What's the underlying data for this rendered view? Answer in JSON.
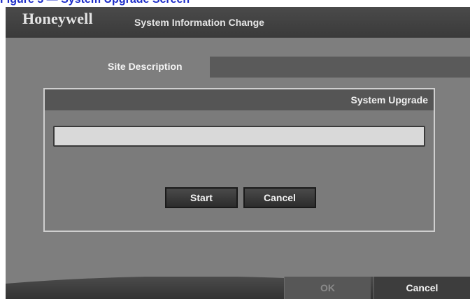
{
  "caption": {
    "text": "Figure 3 — System Upgrade Screen"
  },
  "header": {
    "logo": "Honeywell",
    "title": "System Information Change"
  },
  "site": {
    "label": "Site Description",
    "value": ""
  },
  "upgrade_dialog": {
    "title": "System Upgrade",
    "progress_fraction": 0,
    "start_label": "Start",
    "cancel_label": "Cancel"
  },
  "footer": {
    "ok_label": "OK",
    "ok_enabled": false,
    "cancel_label": "Cancel"
  },
  "colors": {
    "window_bg": "#7e7e7e",
    "bar_dark": "#3a3a3a",
    "caption": "#1c2cc8",
    "progress_track": "#d9d9d9",
    "disabled_text": "#8a8a8a"
  }
}
